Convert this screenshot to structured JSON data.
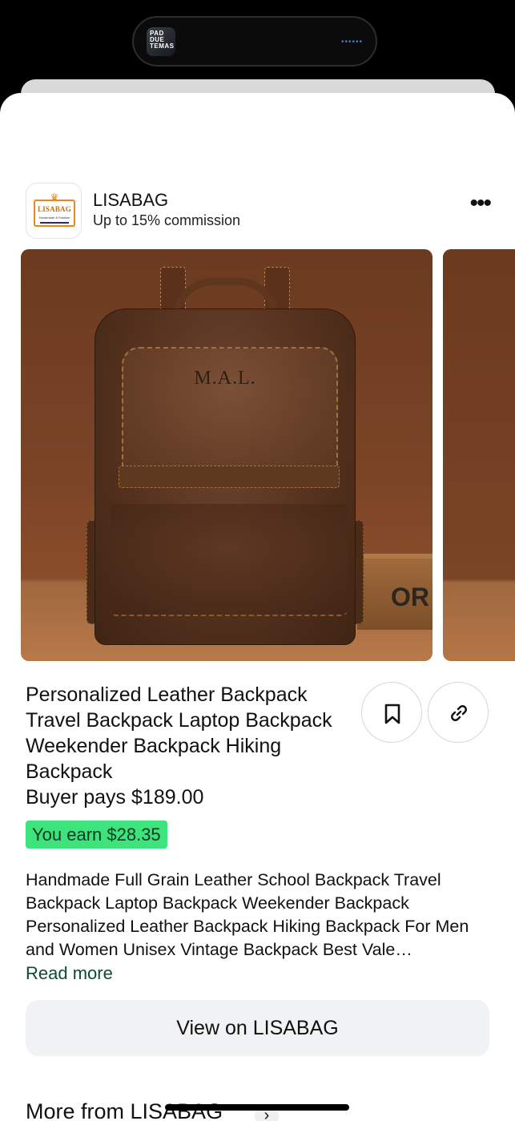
{
  "status": {
    "island_thumb_text": "PAD DUE TEMAS"
  },
  "merchant": {
    "logo_text": "LISABAG",
    "logo_tagline": "Handmade & Fashion",
    "name": "LISABAG",
    "commission": "Up to 15% commission",
    "more_icon": "more-horizontal-icon"
  },
  "product": {
    "image_monogram": "M.A.L.",
    "image_crate_text": "OR",
    "title": "Personalized Leather Backpack Travel Backpack Laptop Backpack Weekender Backpack Hiking Backpack",
    "price": "Buyer pays $189.00",
    "earn": "You earn $28.35",
    "description": "Handmade Full Grain Leather School Backpack Travel Backpack Laptop Backpack Weekender Backpack Personalized Leather Backpack Hiking Backpack For Men and Women Unisex Vintage Backpack Best Vale…",
    "read_more": "Read more",
    "save_icon": "bookmark-icon",
    "link_icon": "link-icon"
  },
  "actions": {
    "view_button": "View on LISABAG"
  },
  "more_from": {
    "label": "More from LISABAG",
    "chevron": "›"
  },
  "colors": {
    "earn_badge": "#3de37d",
    "read_more": "#0d4a35",
    "button_bg": "#f1f2f3"
  }
}
